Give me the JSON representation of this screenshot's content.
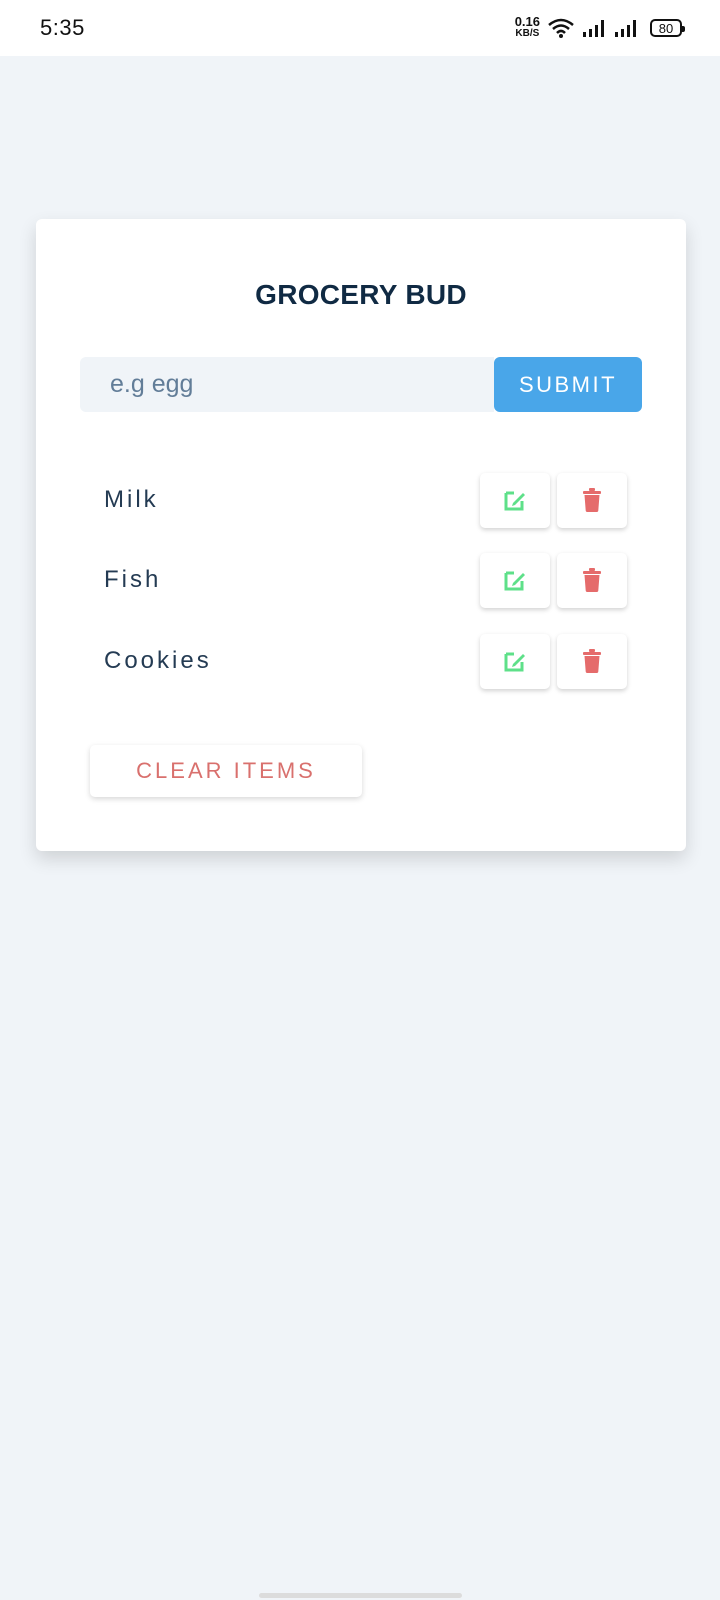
{
  "status_bar": {
    "time": "5:35",
    "net_speed_value": "0.16",
    "net_speed_unit": "KB/S",
    "battery": "80"
  },
  "app": {
    "title": "GROCERY BUD",
    "input": {
      "placeholder": "e.g egg",
      "value": ""
    },
    "submit_label": "SUBMIT",
    "items": [
      {
        "name": "Milk"
      },
      {
        "name": "Fish"
      },
      {
        "name": "Cookies"
      }
    ],
    "clear_label": "CLEAR ITEMS"
  },
  "colors": {
    "background": "#f0f4f8",
    "title": "#102a43",
    "submit": "#49a6e9",
    "edit_icon": "#5ee089",
    "delete_icon": "#e56b6b",
    "clear_text": "#d9706d"
  },
  "icons": {
    "edit": "edit-icon",
    "delete": "trash-icon",
    "wifi": "wifi-icon",
    "signal": "signal-icon",
    "battery": "battery-icon"
  }
}
